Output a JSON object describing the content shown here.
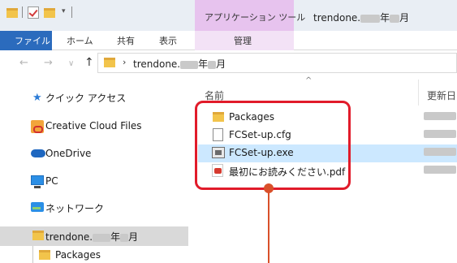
{
  "titlebar": {
    "context_tab": "アプリケーション ツール",
    "window_title_prefix": "trendone.",
    "window_title_year_suffix": "年",
    "window_title_month_suffix": "月"
  },
  "ribbon": {
    "file": "ファイル",
    "home": "ホーム",
    "share": "共有",
    "view": "表示",
    "manage": "管理"
  },
  "address": {
    "path_prefix": "trendone.",
    "path_year_suffix": "年",
    "path_month_suffix": "月"
  },
  "nav": {
    "items": [
      {
        "label": "クイック アクセス",
        "icon": "pin-icon"
      },
      {
        "label": "Creative Cloud Files",
        "icon": "creative-cloud-icon"
      },
      {
        "label": "OneDrive",
        "icon": "onedrive-icon"
      },
      {
        "label": "PC",
        "icon": "pc-icon"
      },
      {
        "label": "ネットワーク",
        "icon": "network-icon"
      }
    ],
    "selected_folder": {
      "prefix": "trendone.",
      "year_suffix": "年",
      "month_suffix": "月"
    },
    "subfolder": "Packages"
  },
  "content": {
    "columns": {
      "name": "名前",
      "modified": "更新日"
    },
    "files": [
      {
        "name": "Packages",
        "icon": "folder-icon"
      },
      {
        "name": "FCSet-up.cfg",
        "icon": "file-icon"
      },
      {
        "name": "FCSet-up.exe",
        "icon": "exe-icon"
      },
      {
        "name": "最初にお読みください.pdf",
        "icon": "pdf-icon"
      }
    ]
  },
  "colors": {
    "highlight": "#e11b2a",
    "marker": "#d9502a",
    "selected_row": "#cce8ff",
    "context_tab": "#e7c3ee",
    "file_tab": "#2b6bbd"
  }
}
